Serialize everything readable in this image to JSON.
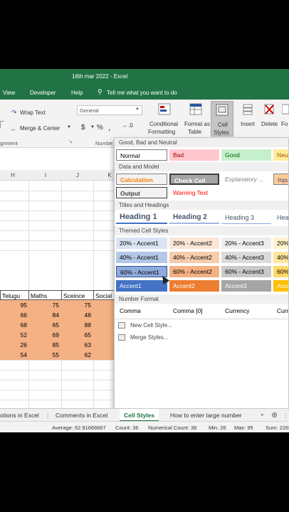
{
  "app": {
    "title": "16th mar 2022  -  Excel"
  },
  "menu": {
    "items": [
      "View",
      "Developer",
      "Help",
      "Tell me what you want to do"
    ]
  },
  "ribbon": {
    "wrap_text": "Wrap Text",
    "merge_center": "Merge & Center",
    "alignment_label": "gnment",
    "number_format": "General",
    "number_label": "Numbe",
    "currency_symbol": "$",
    "percent_symbol": "%",
    "comma_symbol": ",",
    "conditional_formatting": [
      "Conditional",
      "Formatting"
    ],
    "format_as_table": [
      "Format as",
      "Table"
    ],
    "cell_styles": [
      "Cell",
      "Styles"
    ],
    "insert": "Insert",
    "delete": "Delete",
    "format_partial": "Fo"
  },
  "sheet": {
    "columns": [
      "H",
      "I",
      "J",
      "K"
    ],
    "headers": [
      "Telugu",
      "Maths",
      "Sceince",
      "Social"
    ],
    "rows": [
      [
        95,
        75,
        75
      ],
      [
        66,
        84,
        48
      ],
      [
        68,
        65,
        88
      ],
      [
        52,
        69,
        65
      ],
      [
        26,
        85,
        63
      ],
      [
        54,
        55,
        62
      ]
    ]
  },
  "gallery": {
    "sections": {
      "good_bad": "Good, Bad and Neutral",
      "data_model": "Data and Model",
      "titles": "Titles and Headings",
      "themed": "Themed Cell Styles",
      "number_format": "Number Format"
    },
    "good_bad": [
      "Normal",
      "Bad",
      "Good",
      "Neu"
    ],
    "data_model_row1": [
      "Calculation",
      "Check Cell",
      "Explanatory ...",
      "Inpu"
    ],
    "data_model_row2": [
      "Output",
      "Warning Text"
    ],
    "titles": [
      "Heading 1",
      "Heading 2",
      "Heading 3",
      "Hea"
    ],
    "accent20": [
      "20% - Accent1",
      "20% - Accent2",
      "20% - Accent3",
      "20%"
    ],
    "accent40": [
      "40% - Accent1",
      "40% - Accent2",
      "40% - Accent3",
      "40%"
    ],
    "accent60": [
      "60% - Accent1",
      "60% - Accent2",
      "60% - Accent3",
      "60%"
    ],
    "accent": [
      "Accent1",
      "Accent2",
      "Accent3",
      "Acce"
    ],
    "number_format": [
      "Comma",
      "Comma [0]",
      "Currency",
      "Curr"
    ],
    "new_style": "New Cell Style...",
    "merge_styles": "Merge Styles..."
  },
  "tabs": [
    "otions in Excel",
    "Comments in Excel",
    "Cell Styles",
    "How to enter large number"
  ],
  "status": {
    "average": "Average: 62.91666667",
    "count": "Count: 36",
    "numerical_count": "Numerical Count: 36",
    "min": "Min: 26",
    "max": "Max: 95",
    "sum": "Sum: 2265"
  },
  "colors": {
    "excel_green": "#217346",
    "accent_orange": "#f4b183"
  }
}
